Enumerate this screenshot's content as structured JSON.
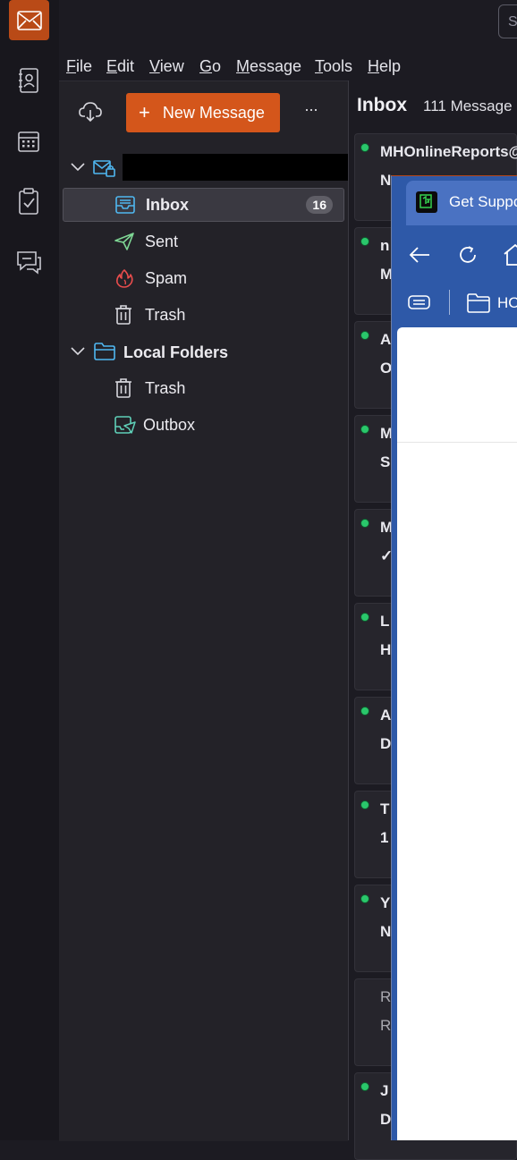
{
  "spaces": {
    "items": [
      {
        "name": "mail-space-icon"
      },
      {
        "name": "address-book-icon"
      },
      {
        "name": "calendar-icon"
      },
      {
        "name": "tasks-icon"
      },
      {
        "name": "chat-icon"
      }
    ]
  },
  "search": {
    "placeholder": "S"
  },
  "menubar": {
    "items": [
      {
        "accel": "F",
        "rest": "ile"
      },
      {
        "accel": "E",
        "rest": "dit"
      },
      {
        "accel": "V",
        "rest": "iew"
      },
      {
        "accel": "G",
        "rest": "o"
      },
      {
        "accel": "M",
        "rest": "essage"
      },
      {
        "accel": "T",
        "rest": "ools"
      },
      {
        "accel": "H",
        "rest": "elp"
      }
    ]
  },
  "folder_pane": {
    "new_message_plus": "+",
    "new_message_label": "New Message",
    "more_label": "···",
    "account_name": "",
    "folders": [
      {
        "label": "Inbox",
        "badge": "16",
        "selected": true
      },
      {
        "label": "Sent"
      },
      {
        "label": "Spam"
      },
      {
        "label": "Trash"
      }
    ],
    "local_folders_label": "Local Folders",
    "local_folders": [
      {
        "label": "Trash"
      },
      {
        "label": "Outbox"
      }
    ]
  },
  "thread_pane": {
    "title": "Inbox",
    "count": "111 Message",
    "messages": [
      {
        "sender": "MHOnlineReports@",
        "subject": "N",
        "unread": true
      },
      {
        "sender": "n",
        "subject": "M",
        "unread": true
      },
      {
        "sender": "A",
        "subject": "O",
        "unread": true
      },
      {
        "sender": "M",
        "subject": "S",
        "unread": true
      },
      {
        "sender": "M",
        "subject": "✓",
        "unread": true
      },
      {
        "sender": "L",
        "subject": "H",
        "unread": true
      },
      {
        "sender": "A",
        "subject": "D",
        "unread": true
      },
      {
        "sender": "T",
        "subject": "1",
        "unread": true
      },
      {
        "sender": "Y",
        "subject": "N",
        "unread": true
      },
      {
        "sender": "R",
        "subject": "R",
        "unread": false
      },
      {
        "sender": "J",
        "subject": "D",
        "unread": true
      }
    ]
  },
  "browser": {
    "tab_title": "Get Suppo",
    "bookmark_label": "HO"
  },
  "colors": {
    "accent": "#d4561b",
    "unread_dot": "#2ac76b",
    "browser_frame": "#2e59a8"
  }
}
